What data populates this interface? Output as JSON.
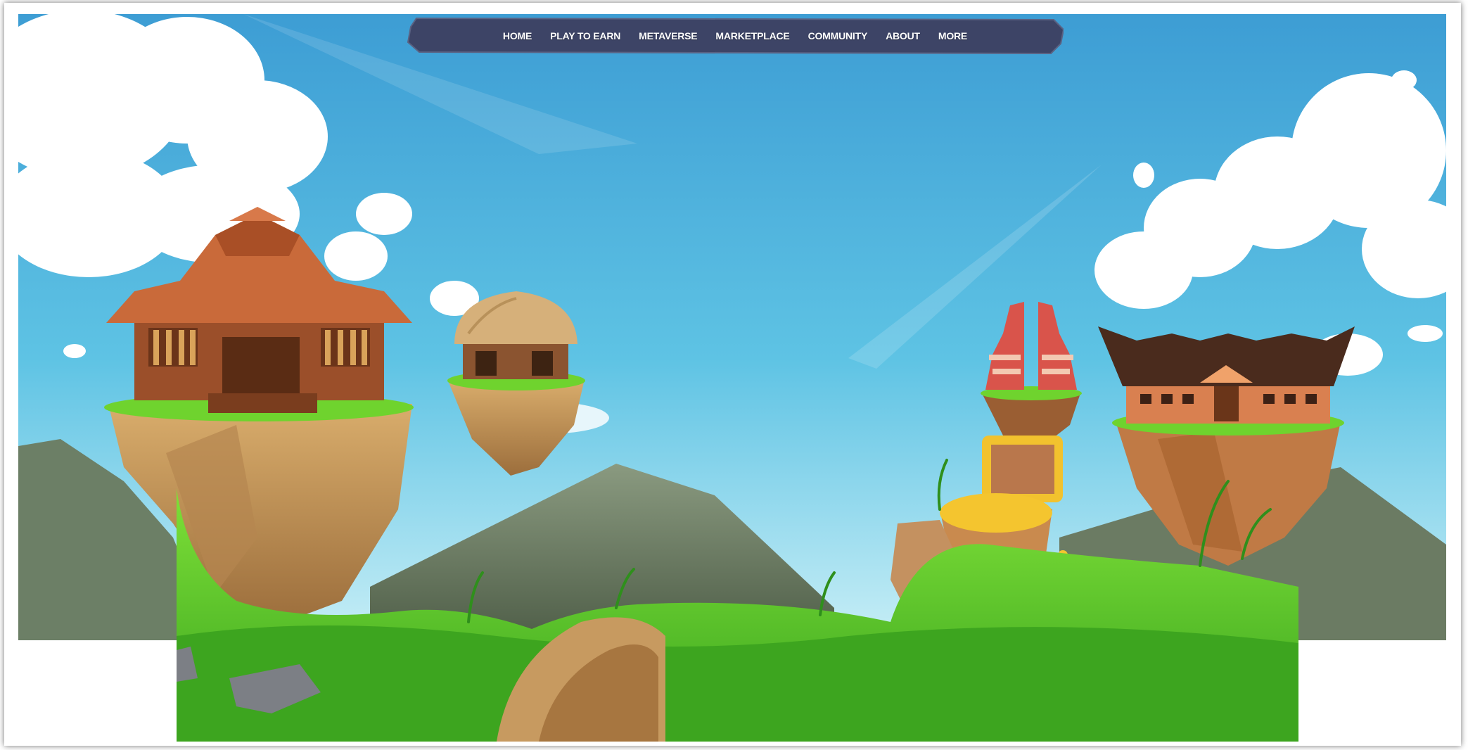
{
  "nav": {
    "items": [
      {
        "label": "HOME"
      },
      {
        "label": "PLAY TO EARN"
      },
      {
        "label": "METAVERSE"
      },
      {
        "label": "MARKETPLACE"
      },
      {
        "label": "COMMUNITY"
      },
      {
        "label": "ABOUT"
      },
      {
        "label": "MORE"
      }
    ]
  },
  "colors": {
    "sky_top": "#3b9fd6",
    "sky_bottom": "#bfe8f5",
    "nav_bg": "#3d4466",
    "grass": "#5fd42a",
    "grass_dark": "#2f8f1c",
    "rock": "#c89a5c",
    "mountain": "#6f7e66"
  },
  "icons": [
    "javanese-house-island",
    "thatched-hut-island",
    "temple-gate-island",
    "minangkabau-house-island",
    "treasure-chest"
  ]
}
